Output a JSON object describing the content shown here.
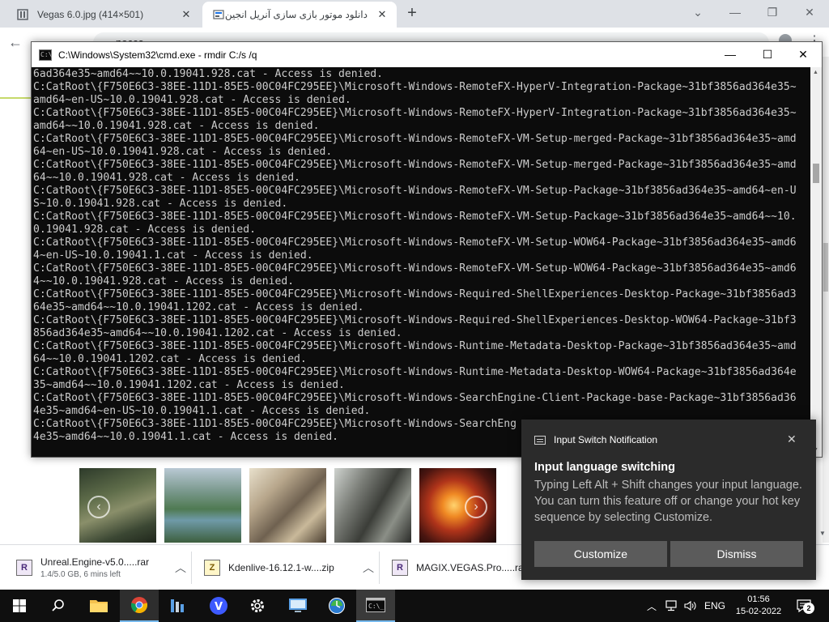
{
  "browser": {
    "tabs": [
      {
        "title": "Vegas 6.0.jpg (414×501)",
        "favicon": "image-doc-icon",
        "active": false
      },
      {
        "title": "دانلود موتور بازی سازی آنریل انجین",
        "favicon": "site-icon",
        "active": true
      }
    ],
    "address_fragment": "nocco"
  },
  "cmd": {
    "title": "C:\\Windows\\System32\\cmd.exe - rmdir  C:/s /q",
    "lines": [
      "6ad364e35~amd64~~10.0.19041.928.cat - Access is denied.",
      "C:CatRoot\\{F750E6C3-38EE-11D1-85E5-00C04FC295EE}\\Microsoft-Windows-RemoteFX-HyperV-Integration-Package~31bf3856ad364e35~",
      "amd64~en-US~10.0.19041.928.cat - Access is denied.",
      "C:CatRoot\\{F750E6C3-38EE-11D1-85E5-00C04FC295EE}\\Microsoft-Windows-RemoteFX-HyperV-Integration-Package~31bf3856ad364e35~",
      "amd64~~10.0.19041.928.cat - Access is denied.",
      "C:CatRoot\\{F750E6C3-38EE-11D1-85E5-00C04FC295EE}\\Microsoft-Windows-RemoteFX-VM-Setup-merged-Package~31bf3856ad364e35~amd",
      "64~en-US~10.0.19041.928.cat - Access is denied.",
      "C:CatRoot\\{F750E6C3-38EE-11D1-85E5-00C04FC295EE}\\Microsoft-Windows-RemoteFX-VM-Setup-merged-Package~31bf3856ad364e35~amd",
      "64~~10.0.19041.928.cat - Access is denied.",
      "C:CatRoot\\{F750E6C3-38EE-11D1-85E5-00C04FC295EE}\\Microsoft-Windows-RemoteFX-VM-Setup-Package~31bf3856ad364e35~amd64~en-U",
      "S~10.0.19041.928.cat - Access is denied.",
      "C:CatRoot\\{F750E6C3-38EE-11D1-85E5-00C04FC295EE}\\Microsoft-Windows-RemoteFX-VM-Setup-Package~31bf3856ad364e35~amd64~~10.",
      "0.19041.928.cat - Access is denied.",
      "C:CatRoot\\{F750E6C3-38EE-11D1-85E5-00C04FC295EE}\\Microsoft-Windows-RemoteFX-VM-Setup-WOW64-Package~31bf3856ad364e35~amd6",
      "4~en-US~10.0.19041.1.cat - Access is denied.",
      "C:CatRoot\\{F750E6C3-38EE-11D1-85E5-00C04FC295EE}\\Microsoft-Windows-RemoteFX-VM-Setup-WOW64-Package~31bf3856ad364e35~amd6",
      "4~~10.0.19041.928.cat - Access is denied.",
      "C:CatRoot\\{F750E6C3-38EE-11D1-85E5-00C04FC295EE}\\Microsoft-Windows-Required-ShellExperiences-Desktop-Package~31bf3856ad3",
      "64e35~amd64~~10.0.19041.1202.cat - Access is denied.",
      "C:CatRoot\\{F750E6C3-38EE-11D1-85E5-00C04FC295EE}\\Microsoft-Windows-Required-ShellExperiences-Desktop-WOW64-Package~31bf3",
      "856ad364e35~amd64~~10.0.19041.1202.cat - Access is denied.",
      "C:CatRoot\\{F750E6C3-38EE-11D1-85E5-00C04FC295EE}\\Microsoft-Windows-Runtime-Metadata-Desktop-Package~31bf3856ad364e35~amd",
      "64~~10.0.19041.1202.cat - Access is denied.",
      "C:CatRoot\\{F750E6C3-38EE-11D1-85E5-00C04FC295EE}\\Microsoft-Windows-Runtime-Metadata-Desktop-WOW64-Package~31bf3856ad364e",
      "35~amd64~~10.0.19041.1202.cat - Access is denied.",
      "C:CatRoot\\{F750E6C3-38EE-11D1-85E5-00C04FC295EE}\\Microsoft-Windows-SearchEngine-Client-Package-base-Package~31bf3856ad36",
      "4e35~amd64~en-US~10.0.19041.1.cat - Access is denied.",
      "C:CatRoot\\{F750E6C3-38EE-11D1-85E5-00C04FC295EE}\\Microsoft-Windows-SearchEng",
      "4e35~amd64~~10.0.19041.1.cat - Access is denied."
    ]
  },
  "notification": {
    "app": "Input Switch Notification",
    "heading": "Input language switching",
    "body": "Typing Left Alt + Shift changes your input language. You can turn this feature off or change your hot key sequence by selecting Customize.",
    "customize_label": "Customize",
    "dismiss_label": "Dismiss"
  },
  "downloads": [
    {
      "name": "Unreal.Engine-v5.0.....rar",
      "status": "1.4/5.0 GB, 6 mins left",
      "icon": "R"
    },
    {
      "name": "Kdenlive-16.12.1-w....zip",
      "status": "",
      "icon": "Z"
    },
    {
      "name": "MAGIX.VEGAS.Pro.....rar",
      "status": "",
      "icon": "R"
    }
  ],
  "taskbar": {
    "language": "ENG",
    "time": "01:56",
    "date": "15-02-2022",
    "notification_count": "2",
    "accent": "#76b9ed"
  }
}
